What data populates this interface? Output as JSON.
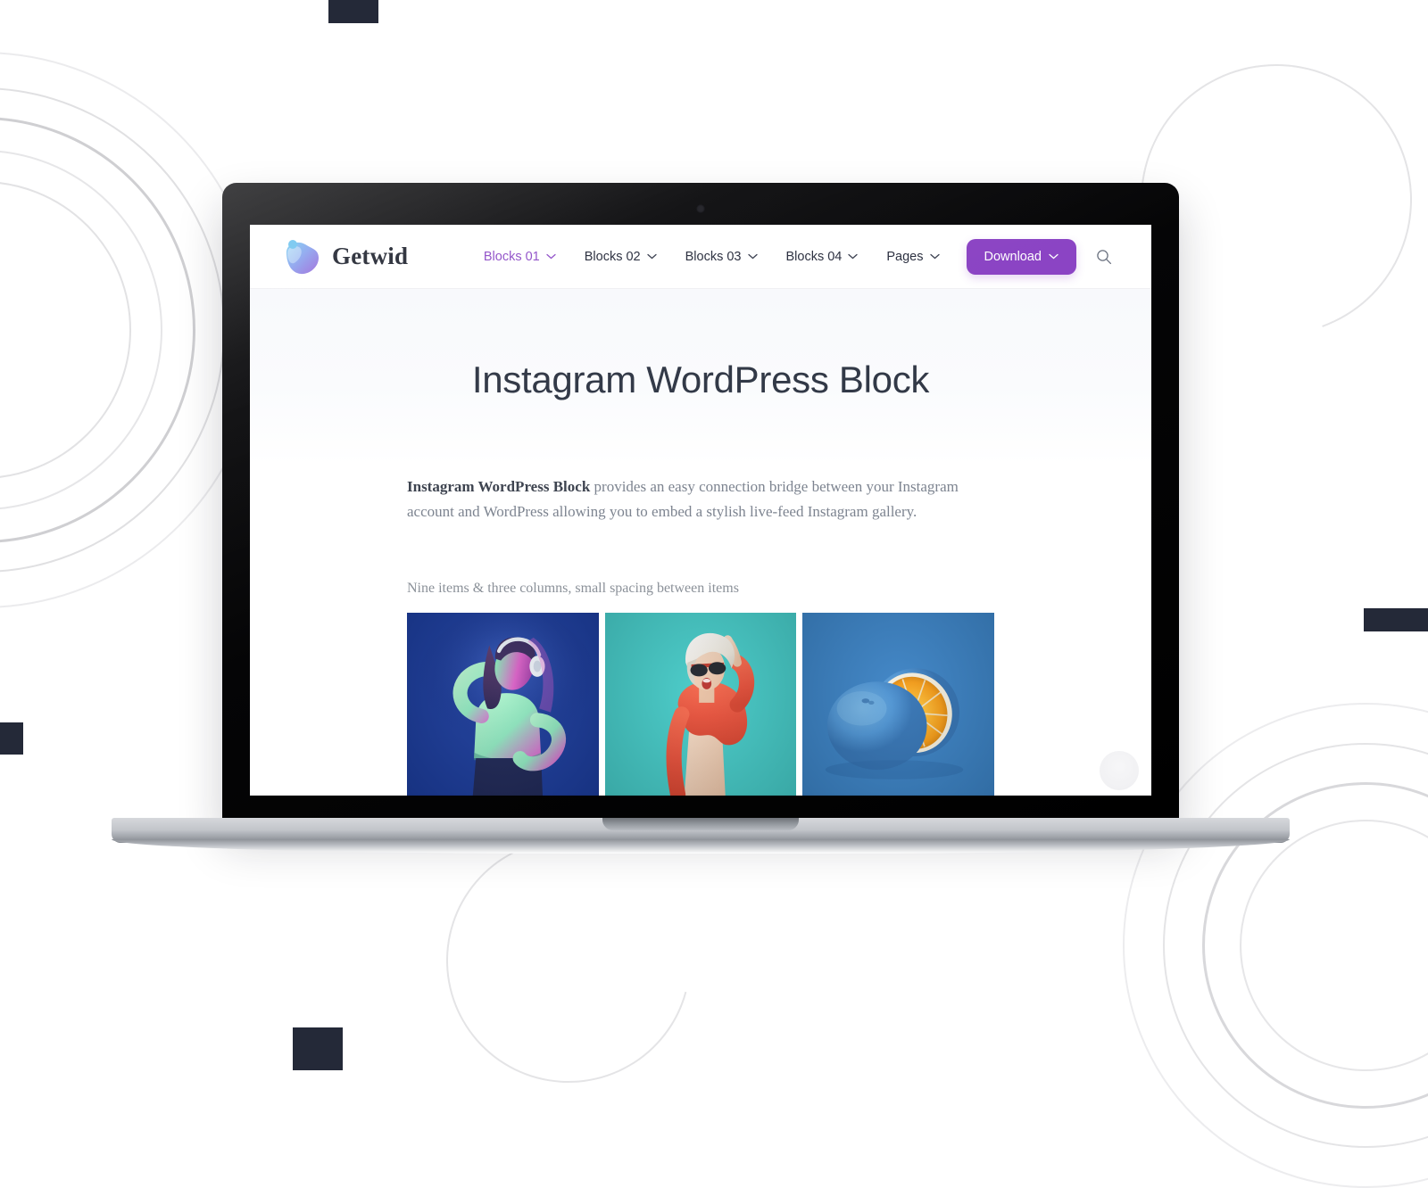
{
  "scene": {
    "device": "laptop-mockup",
    "background_color": "#ffffff",
    "accent_color": "#8b44c4",
    "deco_line_color": "#e2e2e4",
    "deco_square_color": "#242938"
  },
  "site": {
    "brand": {
      "name": "Getwid",
      "logo_icon": "getwid-heart-logo"
    },
    "nav": {
      "items": [
        {
          "label": "Blocks 01",
          "active": true,
          "has_dropdown": true
        },
        {
          "label": "Blocks 02",
          "active": false,
          "has_dropdown": true
        },
        {
          "label": "Blocks 03",
          "active": false,
          "has_dropdown": true
        },
        {
          "label": "Blocks 04",
          "active": false,
          "has_dropdown": true
        },
        {
          "label": "Pages",
          "active": false,
          "has_dropdown": true
        }
      ],
      "download_label": "Download",
      "search_icon": "search-icon"
    },
    "hero": {
      "title": "Instagram WordPress Block"
    },
    "content": {
      "intro_strong": "Instagram WordPress Block",
      "intro_rest": " provides an easy connection bridge between your Instagram account and WordPress allowing you to embed a stylish live-feed Instagram gallery.",
      "gallery_caption": "Nine items & three columns, small spacing between items",
      "gallery": {
        "columns": 3,
        "items": [
          {
            "alt": "Woman with headphones dancing in neon pink and green light on blue background"
          },
          {
            "alt": "Woman with white hair and sunglasses in red sweater on turquoise background"
          },
          {
            "alt": "Blue painted orange cut in half on blue background"
          }
        ]
      }
    }
  }
}
